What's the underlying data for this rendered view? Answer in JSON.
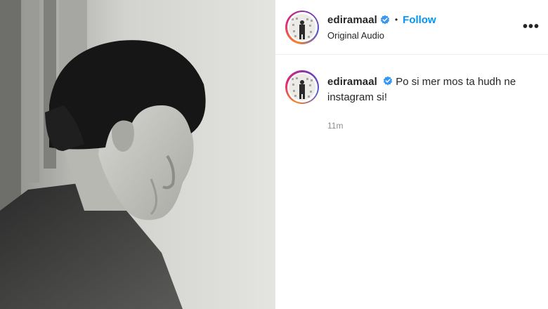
{
  "post": {
    "media": {
      "icon": "video-frame",
      "colors": {
        "background": "#dcdcda",
        "hair": "#161616",
        "skin": "#c4c4c0"
      }
    },
    "header": {
      "username": "ediramaal",
      "follow_label": "Follow",
      "separator": "•",
      "subtitle": "Original Audio",
      "more_label": "•••"
    },
    "caption": {
      "username": "ediramaal",
      "text": "Po si mer mos ta hudh ne instagram si!",
      "timestamp": "11m"
    },
    "colors": {
      "accent": "#0095f6",
      "verified": "#3897f0"
    }
  }
}
